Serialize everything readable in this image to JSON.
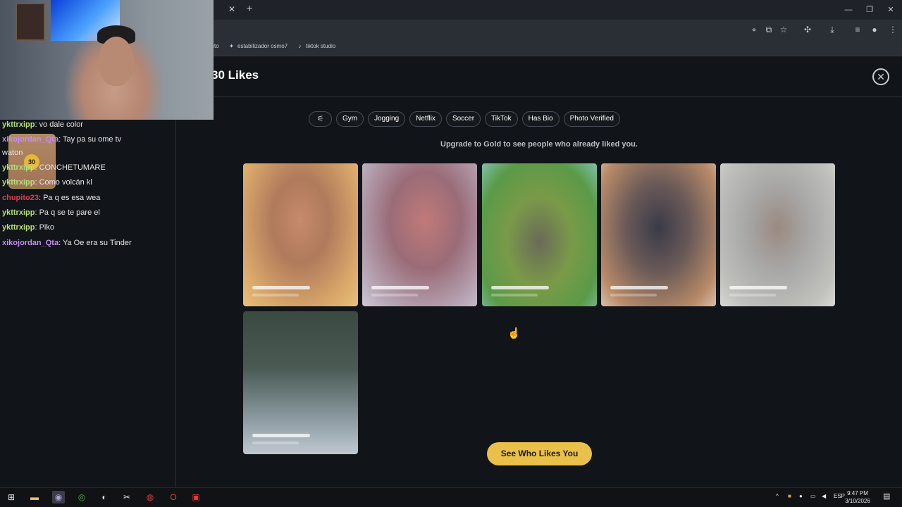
{
  "browser": {
    "bookmarks": [
      {
        "label": "cto",
        "icon": "bookmark-icon"
      },
      {
        "label": "estabilizador osmo7",
        "icon": "star-favicon-icon"
      },
      {
        "label": "tiktok studio",
        "icon": "tiktok-icon"
      }
    ]
  },
  "page": {
    "title": "30 Likes",
    "filters": [
      "Gym",
      "Jogging",
      "Netflix",
      "Soccer",
      "TikTok",
      "Has Bio",
      "Photo Verified"
    ],
    "upgrade_text": "Upgrade to Gold to see people who already liked you.",
    "cta_label": "See Who Likes You",
    "accent_color": "#e9c04a",
    "card_count_shown": 6
  },
  "chat": {
    "messages": [
      {
        "user": "ykttrxipp",
        "color": "#b5e07a",
        "text": ": vo dale color"
      },
      {
        "user": "xikojordan_Qta",
        "color": "#c58cf0",
        "text": ": Tay pa su ome tv"
      },
      {
        "user": "",
        "color": "#e6e6e6",
        "text": "waton"
      },
      {
        "user": "ykttrxipp",
        "color": "#b5e07a",
        "text": ": CONCHETUMARE"
      },
      {
        "user": "ykttrxipp",
        "color": "#b5e07a",
        "text": ": Como volcán kl"
      },
      {
        "user": "chupito23",
        "color": "#e23a52",
        "text": ": Pa q es esa wea"
      },
      {
        "user": "ykttrxipp",
        "color": "#b5e07a",
        "text": ": Pa q se te pare el"
      },
      {
        "user": "ykttrxipp",
        "color": "#b5e07a",
        "text": ": Piko"
      },
      {
        "user": "xikojordan_Qta",
        "color": "#c58cf0",
        "text": ": Ya Oe era su Tinder"
      }
    ],
    "badge_count": "30",
    "badge_label": "30 Likes"
  },
  "taskbar": {
    "language": "ESP",
    "time": "9:47 PM",
    "date": "3/10/2026"
  }
}
